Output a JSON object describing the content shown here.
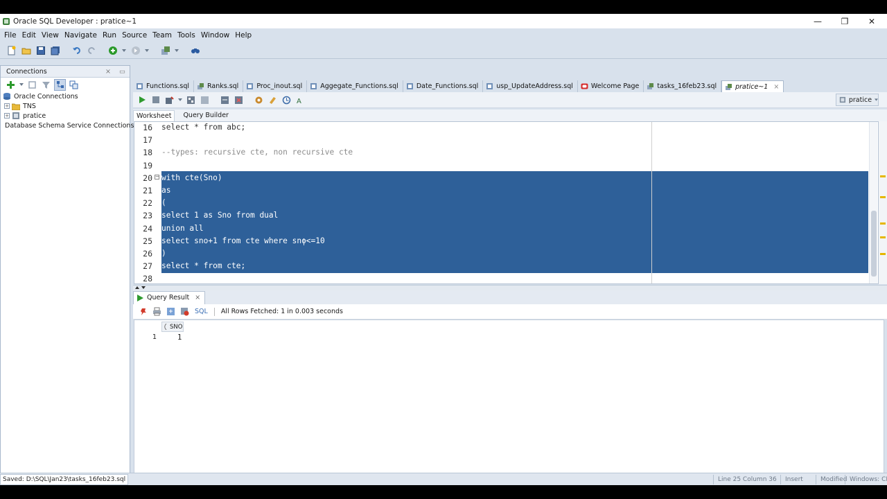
{
  "window": {
    "title": "Oracle SQL Developer : pratice~1"
  },
  "menu": [
    "File",
    "Edit",
    "View",
    "Navigate",
    "Run",
    "Source",
    "Team",
    "Tools",
    "Window",
    "Help"
  ],
  "connections_panel": {
    "title": "Connections",
    "tree": [
      {
        "label": "Oracle Connections",
        "level": 0
      },
      {
        "label": "TNS",
        "level": 1
      },
      {
        "label": "pratice",
        "level": 1
      },
      {
        "label": "Database Schema Service Connections",
        "level": 0
      }
    ]
  },
  "editor_tabs": [
    {
      "label": "Functions.sql"
    },
    {
      "label": "Ranks.sql"
    },
    {
      "label": "Proc_inout.sql"
    },
    {
      "label": "Aggegate_Functions.sql"
    },
    {
      "label": "Date_Functions.sql"
    },
    {
      "label": "usp_UpdateAddress.sql"
    },
    {
      "label": "Welcome Page"
    },
    {
      "label": "tasks_16feb23.sql"
    },
    {
      "label": "pratice~1",
      "active": true
    }
  ],
  "connection_selector": {
    "value": "pratice"
  },
  "sub_tabs": [
    "Worksheet",
    "Query Builder"
  ],
  "code_lines": [
    {
      "num": "16",
      "text": "select * from abc;",
      "selected": false
    },
    {
      "num": "17",
      "text": "",
      "selected": false
    },
    {
      "num": "18",
      "text": "--types: recursive cte, non recursive cte",
      "selected": false,
      "comment": true
    },
    {
      "num": "19",
      "text": "",
      "selected": false
    },
    {
      "num": "20",
      "text": "with cte(Sno)",
      "selected": true
    },
    {
      "num": "21",
      "text": "as",
      "selected": true
    },
    {
      "num": "22",
      "text": "(",
      "selected": true
    },
    {
      "num": "23",
      "text": "select 1 as Sno from dual",
      "selected": true
    },
    {
      "num": "24",
      "text": "union all",
      "selected": true
    },
    {
      "num": "25",
      "text": "select sno+1 from cte where sno<=10",
      "selected": true
    },
    {
      "num": "26",
      "text": ")",
      "selected": true
    },
    {
      "num": "27",
      "text": "select * from cte;",
      "selected": true
    },
    {
      "num": "28",
      "text": "",
      "selected": false
    }
  ],
  "query_result": {
    "tab_label": "Query Result",
    "sql_label": "SQL",
    "status": "All Rows Fetched: 1 in 0.003 seconds",
    "columns": [
      "SNO"
    ],
    "rows": [
      {
        "rownum": "1",
        "values": [
          "1"
        ]
      }
    ]
  },
  "statusbar": {
    "saved": "Saved: D:\\SQL\\Jan23\\tasks_16feb23.sql",
    "position": "Line 25 Column 36",
    "mode": "Insert",
    "modified": "Modified",
    "encoding": "Windows: CI"
  },
  "colors": {
    "selection": "#2e6099",
    "chrome": "#d8e1ec"
  }
}
